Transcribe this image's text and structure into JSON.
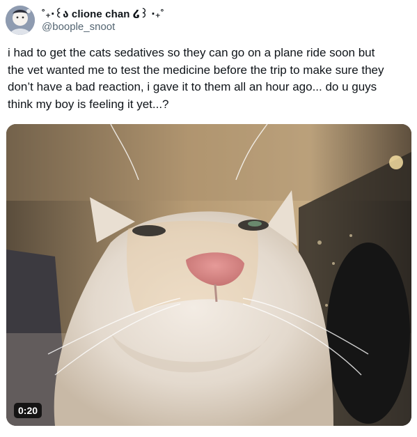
{
  "author": {
    "display_name": "˚₊‧꒰ა clione chan ໒꒱ ‧₊˚",
    "handle": "@boople_snoot"
  },
  "tweet": {
    "text_lines": [
      "i had to get the cats sedatives so they can go on a plane ride soon but",
      "the vet wanted me to test the medicine before the trip to make sure they",
      "don’t have a bad reaction, i gave it to them all an hour ago... do u guys",
      "think my boy is feeling it yet...?"
    ]
  },
  "media": {
    "type": "video",
    "duration": "0:20",
    "subject": "close-up of a sleepy white cat"
  },
  "icons": {
    "avatar": "avatar-icon"
  }
}
